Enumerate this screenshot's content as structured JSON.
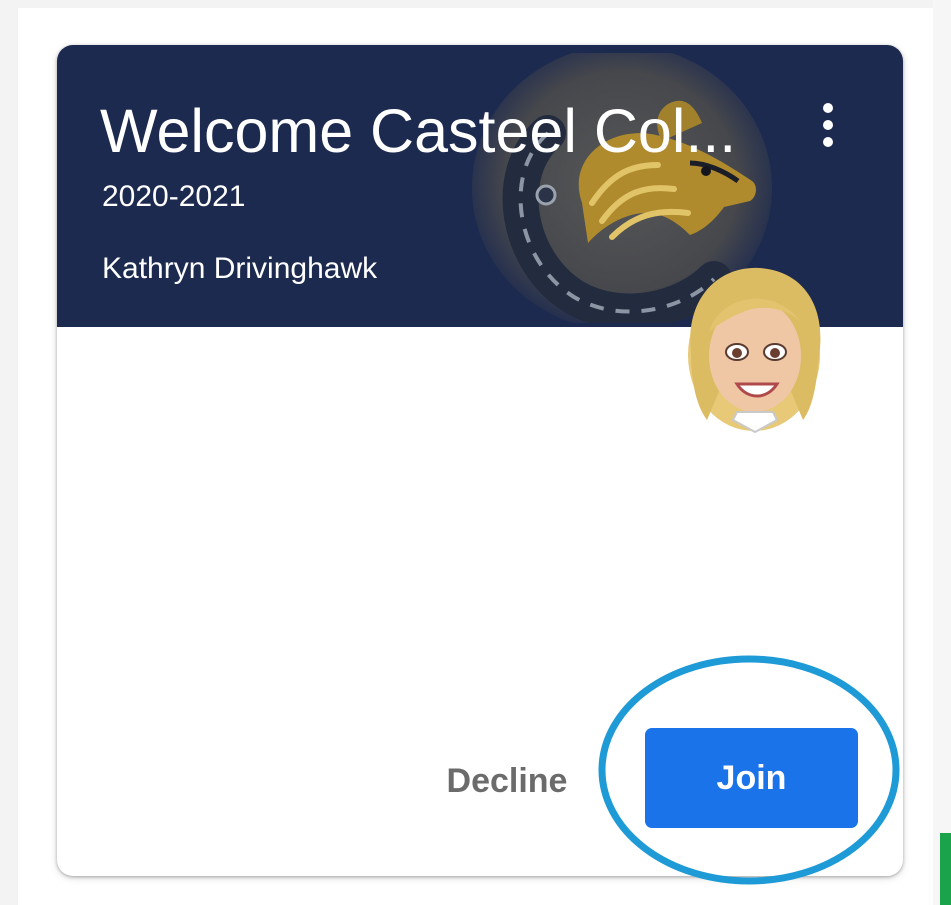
{
  "class_card": {
    "title": "Welcome Casteel Col...",
    "section": "2020-2021",
    "teacher": "Kathryn Drivinghawk",
    "banner_color": "#1d2a4f",
    "banner_image": "mustang-horseshoe-logo",
    "menu_icon": "more-vert-icon",
    "avatar_icon": "teacher-bitmoji-avatar"
  },
  "actions": {
    "decline_label": "Decline",
    "join_label": "Join",
    "join_color": "#1a73e8",
    "decline_color": "#6b6b6b"
  },
  "annotation": {
    "shape": "ellipse",
    "target": "join-button",
    "color": "#1e9ad6"
  }
}
